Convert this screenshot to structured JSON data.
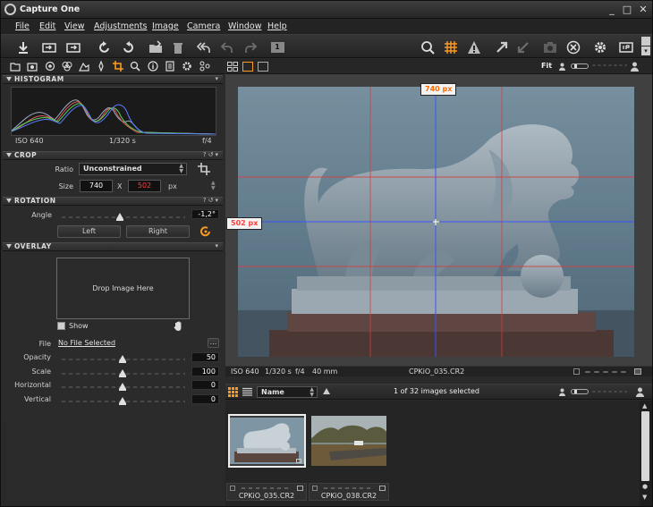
{
  "app": {
    "title": "Capture One"
  },
  "window_controls": {
    "minimize": "_",
    "maximize": "□",
    "close": "✕"
  },
  "menu": [
    "File",
    "Edit",
    "View",
    "Adjustments",
    "Image",
    "Camera",
    "Window",
    "Help"
  ],
  "toolbar": {
    "left_icons": [
      "import-icon",
      "capture-icon",
      "export-icon",
      "rotate-left-icon",
      "rotate-right-icon",
      "move-to-folder-icon",
      "trash-icon",
      "undo-all-icon",
      "undo-icon",
      "redo-icon",
      "single-view-icon"
    ],
    "right_icons": [
      "loupe-icon",
      "grid-overlay-icon",
      "exposure-warning-icon",
      "copy-adjustments-icon",
      "apply-adjustments-icon",
      "camera-icon",
      "reset-icon",
      "settings-icon",
      "preferences-icon"
    ],
    "single_view_label": "1"
  },
  "tool_tabs": [
    "library-icon",
    "capture-tab-icon",
    "lens-icon",
    "color-icon",
    "exposure-icon",
    "details-icon",
    "crop-tab-icon",
    "focus-icon",
    "metadata-icon",
    "output-icon",
    "settings-tab-icon",
    "batch-icon"
  ],
  "histogram": {
    "label": "HISTOGRAM",
    "iso": "ISO 640",
    "shutter": "1/320 s",
    "aperture": "f/4"
  },
  "crop": {
    "label": "CROP",
    "ratio_label": "Ratio",
    "ratio_value": "Unconstrained",
    "size_label": "Size",
    "width": "740",
    "x_label": "X",
    "height": "502",
    "unit": "px"
  },
  "rotation": {
    "label": "ROTATION",
    "angle_label": "Angle",
    "angle_value": "-1,2°",
    "left_label": "Left",
    "right_label": "Right"
  },
  "overlay": {
    "label": "OVERLAY",
    "drop_text": "Drop Image Here",
    "show_label": "Show",
    "file_label": "File",
    "file_value": "No File Selected",
    "browse_label": "...",
    "opacity_label": "Opacity",
    "opacity_value": "50",
    "scale_label": "Scale",
    "scale_value": "100",
    "horizontal_label": "Horizontal",
    "horizontal_value": "0",
    "vertical_label": "Vertical",
    "vertical_value": "0"
  },
  "viewer": {
    "fit_label": "Fit",
    "crop_width_tag": "740 px",
    "crop_height_tag": "502 px"
  },
  "status": {
    "iso": "ISO 640",
    "shutter": "1/320 s",
    "aperture": "f/4",
    "focal": "40 mm",
    "filename": "CPKiO_035.CR2"
  },
  "browser": {
    "sort_label": "Name",
    "selection_status": "1 of 32 images selected",
    "thumbnails": [
      {
        "name": "CPKiO_035.CR2",
        "selected": true
      },
      {
        "name": "CPKiO_038.CR2",
        "selected": false
      }
    ]
  },
  "colors": {
    "accent_orange": "#ff9a1f",
    "crop_red": "#ff3d3d",
    "guide_blue": "#3a55ff"
  }
}
